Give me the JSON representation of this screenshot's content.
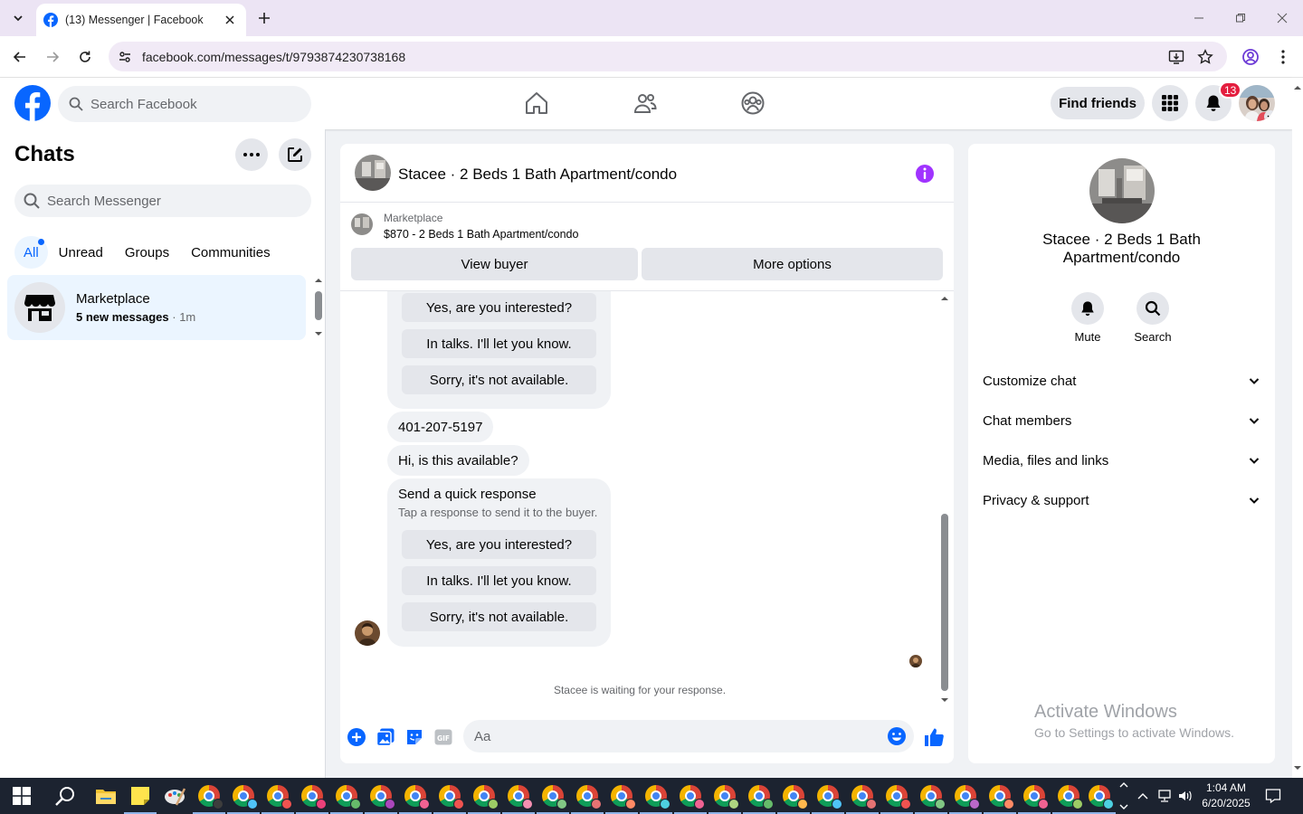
{
  "browser": {
    "tab_title": "(13) Messenger | Facebook",
    "url": "facebook.com/messages/t/9793874230738168"
  },
  "fb": {
    "search_placeholder": "Search Facebook",
    "find_friends": "Find friends",
    "notification_count": "13",
    "brand_color": "#0866ff"
  },
  "sidebar": {
    "title": "Chats",
    "search_placeholder": "Search Messenger",
    "filters": [
      "All",
      "Unread",
      "Groups",
      "Communities"
    ],
    "chats": [
      {
        "name": "Marketplace",
        "preview": "5 new messages",
        "time": "· 1m"
      }
    ]
  },
  "conversation": {
    "name": "Stacee · 2 Beds 1 Bath Apartment/condo",
    "listing_label": "Marketplace",
    "listing_title": "$870 - 2 Beds 1 Bath Apartment/condo",
    "view_buyer": "View buyer",
    "more_options": "More options",
    "quick_replies_top": [
      "Yes, are you interested?",
      "In talks. I'll let you know.",
      "Sorry, it's not available."
    ],
    "phone_message": "401-207-5197",
    "question_message": "Hi, is this available?",
    "quick_response_title": "Send a quick response",
    "quick_response_sub": "Tap a response to send it to the buyer.",
    "quick_replies": [
      "Yes, are you interested?",
      "In talks. I'll let you know.",
      "Sorry, it's not available."
    ],
    "waiting": "Stacee is waiting for your response.",
    "composer_placeholder": "Aa"
  },
  "details": {
    "name": "Stacee · 2 Beds 1 Bath Apartment/condo",
    "mute": "Mute",
    "search": "Search",
    "sections": [
      "Customize chat",
      "Chat members",
      "Media, files and links",
      "Privacy & support"
    ]
  },
  "watermark": {
    "line1": "Activate Windows",
    "line2": "Go to Settings to activate Windows."
  },
  "taskbar": {
    "time": "1:04 AM",
    "date": "6/20/2025"
  }
}
